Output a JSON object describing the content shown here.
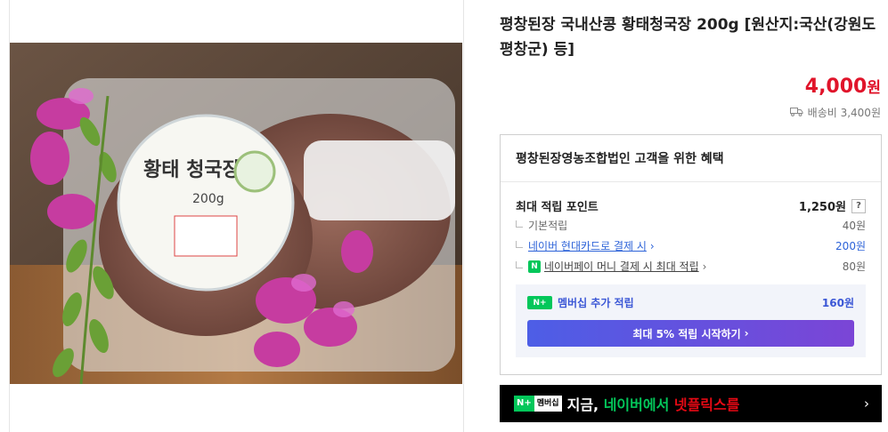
{
  "product": {
    "title": "평창된장 국내산콩 황태청국장 200g [원산지:국산(강원도 평창군) 등]",
    "price": "4,000",
    "price_unit": "원",
    "shipping": "배송비 3,400원"
  },
  "benefits": {
    "heading": "평창된장영농조합법인 고객을 위한 혜택",
    "max_points_label": "최대 적립 포인트",
    "max_points_value": "1,250원",
    "help_label": "?",
    "items": [
      {
        "label": "기본적립",
        "value": "40원"
      },
      {
        "label": "네이버 현대카드로 결제 시",
        "value": "200원"
      },
      {
        "label": "네이버페이 머니 결제 시 최대 적립",
        "value": "80원"
      }
    ],
    "membership": {
      "badge": "N+",
      "label": "멤버십 추가 적립",
      "value": "160원",
      "button_label": "최대 5% 적립 시작하기"
    }
  },
  "banner": {
    "badge_left": "N+",
    "badge_right": "멤버십",
    "text_1": "지금, ",
    "text_2": "네이버에서 ",
    "text_3": "넷플릭스를"
  },
  "image": {
    "label_text": "황태 청국장",
    "weight_text": "200g"
  },
  "colors": {
    "price": "#e0142a",
    "naver_green": "#03c75a",
    "membership_blue": "#3b57d6",
    "netflix_red": "#e50914"
  },
  "icons": [
    "truck-icon",
    "chevron-right-icon",
    "help-icon",
    "npay-icon",
    "naver-plus-icon"
  ]
}
